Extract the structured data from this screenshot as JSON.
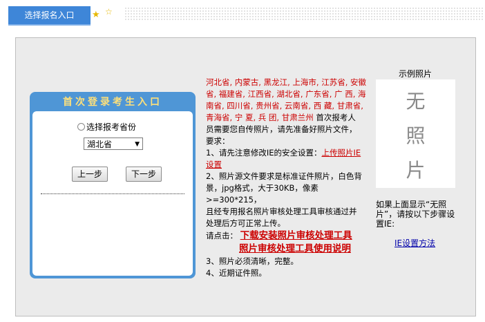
{
  "tab": {
    "label": "选择报名入口"
  },
  "panel": {
    "title": "首次登录考生入口",
    "radio_label": "选择报考省份",
    "province_selected": "湖北省",
    "prev_button": "上一步",
    "next_button": "下一步"
  },
  "info": {
    "provinces_line1": "河北省, 内蒙古, 黑龙江, 上海市, 江苏省, 安徽",
    "provinces_line2": "省, 福建省, 江西省, 湖北省, 广东省, 广 西, 海",
    "provinces_line3": "南省, 四川省, 贵州省, 云南省, 西 藏, 甘肃省,",
    "provinces_line4": "青海省, 宁 夏, 兵 团, 甘肃兰州",
    "line4_rest": " 首次报考人",
    "line5": "员需要您自传照片，请先准备好照片文件，",
    "line6": "要求：",
    "item1_prefix": "1、请先注意修改IE的安全设置：",
    "item1_link_a": "上传照片IE",
    "item1_link_b": "设置",
    "item2_l1": "2、照片源文件要求是标准证件照片，白色背",
    "item2_l2": "景，jpg格式，大于30KB，像素>=300*215，",
    "item2_l3": "且经专用报名照片审核处理工具审核通过并",
    "item2_l4": "处理后方可正常上传。",
    "click_label": "请点击：",
    "download_tool": "下载安装照片审核处理工具",
    "tool_manual": "照片审核处理工具使用说明",
    "item3": "3、照片必须清晰，完整。",
    "item4": "4、近期证件照。"
  },
  "photo": {
    "label": "示例照片",
    "char1": "无",
    "char2": "照",
    "char3": "片",
    "note": "如果上面显示“无照片”，请按以下步骤设置IE:",
    "ie_link": "IE设置方法"
  }
}
